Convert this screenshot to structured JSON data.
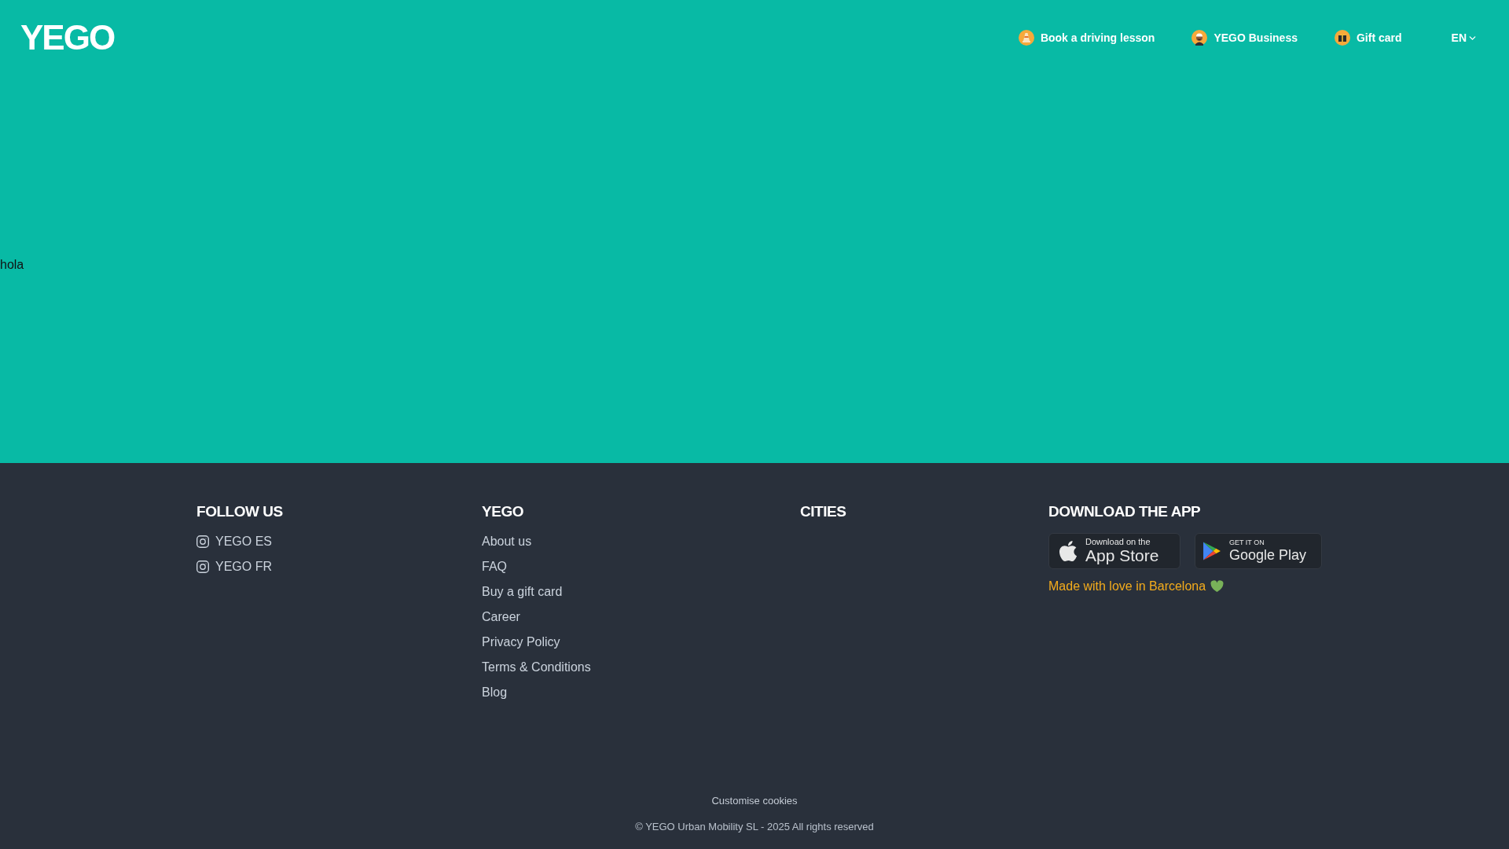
{
  "header": {
    "logo": "YEGO",
    "nav": [
      {
        "label": "Book a driving lesson"
      },
      {
        "label": "YEGO Business"
      },
      {
        "label": "Gift card"
      }
    ],
    "language": "EN"
  },
  "main": {
    "text": "hola"
  },
  "footer": {
    "columns": [
      {
        "kind": "social",
        "title": "FOLLOW US",
        "links": [
          "YEGO ES",
          "YEGO FR"
        ]
      },
      {
        "kind": "links",
        "title": "YEGO",
        "links": [
          "About us",
          "FAQ",
          "Buy a gift card",
          "Career",
          "Privacy Policy",
          "Terms & Conditions",
          "Blog"
        ]
      },
      {
        "kind": "links",
        "title": "CITIES"
      },
      {
        "kind": "apps",
        "title": "DOWNLOAD THE APP",
        "badges": [
          {
            "kind": "appstore",
            "small": "Download on the",
            "big": "App Store"
          },
          {
            "kind": "playstore",
            "small": "GET IT ON",
            "big": "Google Play"
          }
        ],
        "tagline": "Made with love in Barcelona"
      }
    ],
    "cookies": "Customise cookies",
    "copyright": "© YEGO Urban Mobility SL - 2025 All rights reserved"
  }
}
